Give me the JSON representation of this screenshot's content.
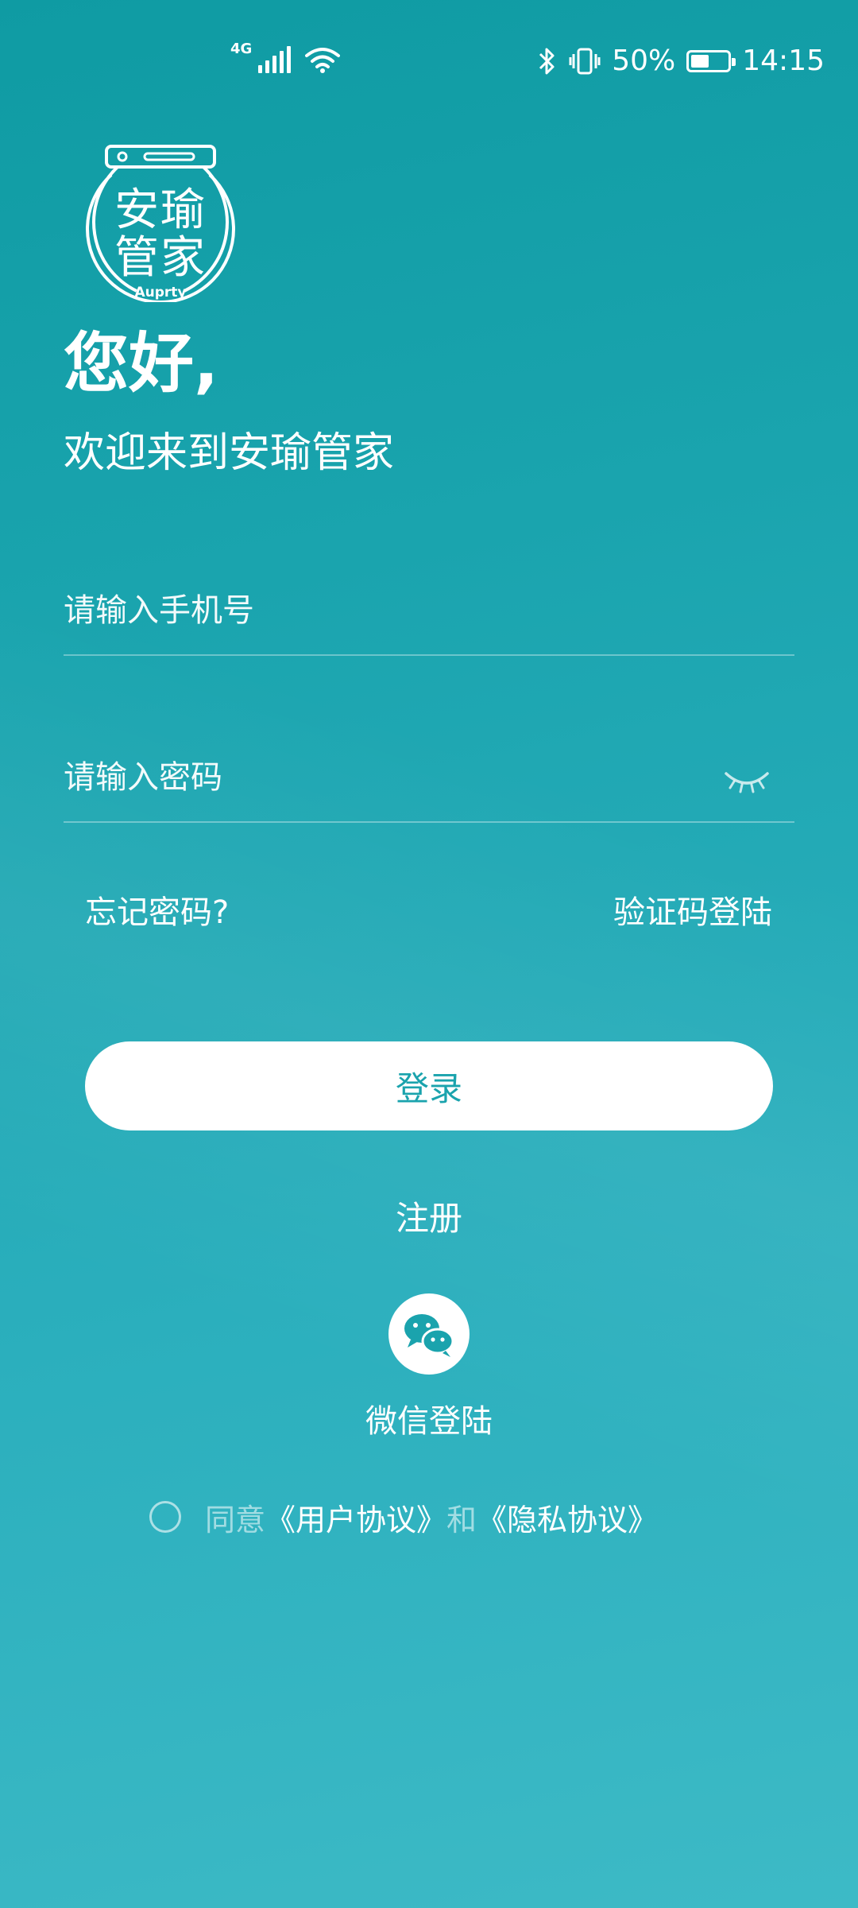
{
  "status_bar": {
    "network_type": "4G",
    "battery_percent_text": "50%",
    "battery_level": 0.5,
    "time": "14:15",
    "icons": [
      "signal-icon",
      "wifi-icon",
      "bluetooth-icon",
      "vibrate-icon",
      "battery-icon"
    ]
  },
  "logo": {
    "text_line1": "安瑜",
    "text_line2": "管家",
    "subtitle": "Auprty"
  },
  "greeting": {
    "title": "您好,",
    "subtitle": "欢迎来到安瑜管家"
  },
  "form": {
    "phone_placeholder": "请输入手机号",
    "phone_value": "",
    "password_placeholder": "请输入密码",
    "password_value": "",
    "password_toggle_icon": "eye-closed-icon"
  },
  "links": {
    "forgot_password": "忘记密码?",
    "sms_login": "验证码登陆"
  },
  "buttons": {
    "login": "登录",
    "register": "注册"
  },
  "wechat": {
    "icon": "wechat-icon",
    "label": "微信登陆"
  },
  "agreement": {
    "prefix": "同意",
    "user_agreement": "《用户协议》",
    "conjunction": "和",
    "privacy_agreement": "《隐私协议》",
    "checked": false
  },
  "colors": {
    "background_top": "#0f9ba3",
    "background_bottom": "#3dbac6",
    "accent": "#1aa3ad",
    "button_bg": "#ffffff"
  }
}
